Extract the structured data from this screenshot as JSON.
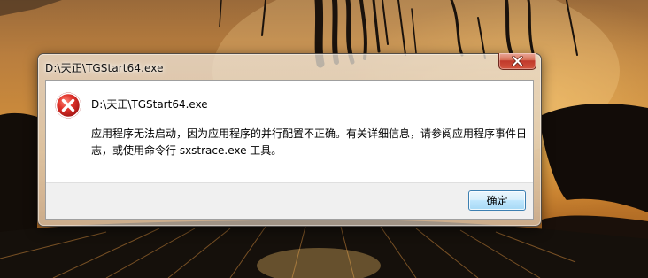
{
  "window": {
    "title": "D:\\天正\\TGStart64.exe"
  },
  "dialog": {
    "icon": "error-icon",
    "header": "D:\\天正\\TGStart64.exe",
    "message": "应用程序无法启动，因为应用程序的并行配置不正确。有关详细信息，请参阅应用程序事件日志，或使用命令行 sxstrace.exe 工具。",
    "ok_label": "确定"
  },
  "colors": {
    "error_red": "#d12b2b",
    "button_border": "#3c7fb1",
    "close_red": "#c0392b"
  }
}
